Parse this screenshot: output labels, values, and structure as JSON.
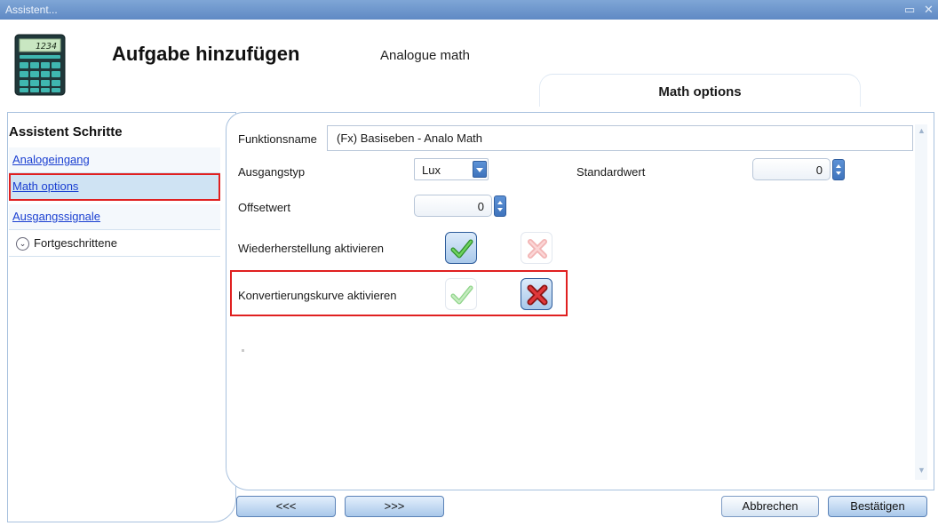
{
  "window": {
    "title": "Assistent..."
  },
  "header": {
    "title": "Aufgabe hinzufügen",
    "subtitle": "Analogue math",
    "active_tab": "Math options",
    "calculator_display": "1234"
  },
  "steps": {
    "title": "Assistent Schritte",
    "items": [
      {
        "label": "Analogeingang",
        "selected": false
      },
      {
        "label": "Math options",
        "selected": true
      },
      {
        "label": "Ausgangssignale",
        "selected": false
      }
    ],
    "advanced_label": "Fortgeschrittene"
  },
  "form": {
    "function_name_label": "Funktionsname",
    "function_name_value": "(Fx) Basiseben - Analo Math",
    "output_type_label": "Ausgangstyp",
    "output_type_value": "Lux",
    "default_value_label": "Standardwert",
    "default_value": "0",
    "offset_label": "Offsetwert",
    "offset_value": "0",
    "restore_label": "Wiederherstellung aktivieren",
    "restore_enabled": true,
    "curve_label": "Konvertierungskurve aktivieren",
    "curve_enabled": false
  },
  "footer": {
    "prev": "<<<",
    "next": ">>>",
    "cancel": "Abbrechen",
    "confirm": "Bestätigen"
  },
  "colors": {
    "titlebar": "#6f98cf",
    "link": "#1a3fd1",
    "highlight": "#e02020",
    "check_green": "#3aa635",
    "cross_red": "#d9262a"
  }
}
